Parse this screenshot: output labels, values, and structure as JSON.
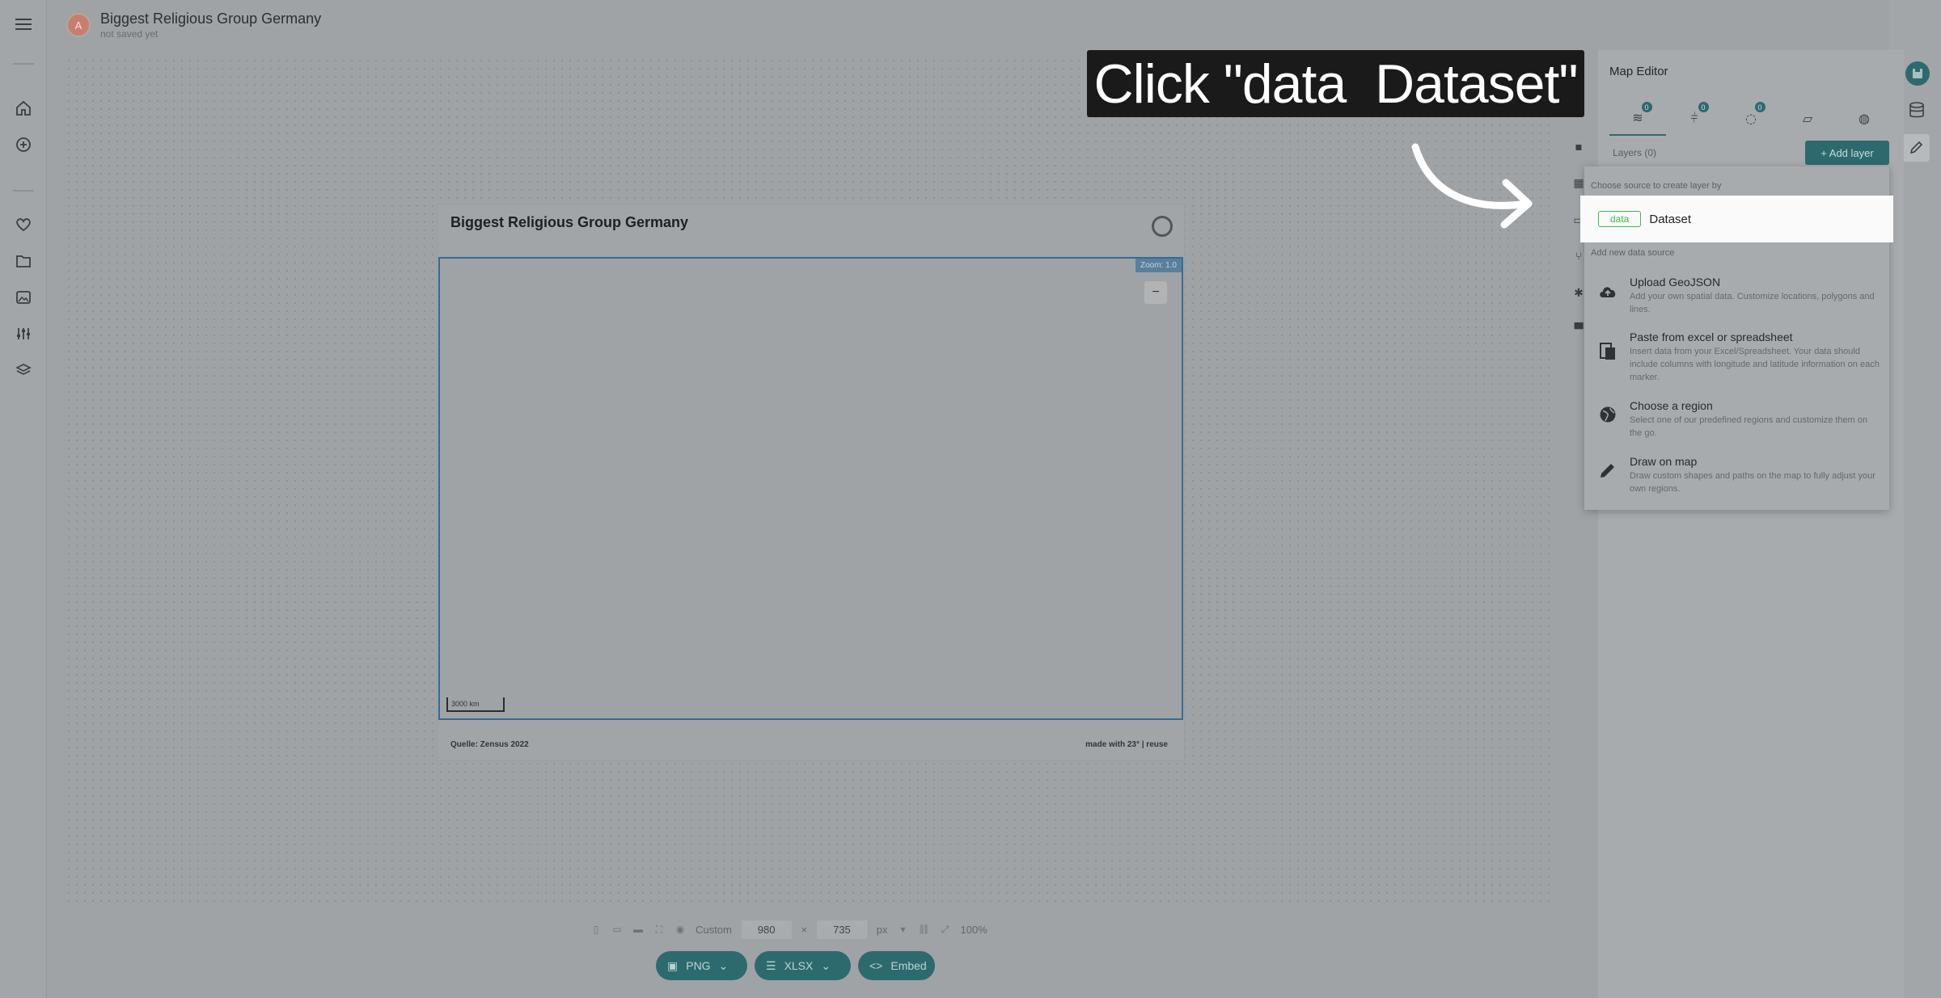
{
  "app": {
    "avatar_letter": "A",
    "doc_title": "Biggest Religious Group Germany",
    "doc_status": "not saved yet"
  },
  "map_card": {
    "title": "Biggest Religious Group Germany",
    "zoom_label": "Zoom: 1.0",
    "zoom_in": "+",
    "zoom_out": "−",
    "scale_label": "3000 km",
    "source": "Quelle: Zensus 2022",
    "made_with": "made with 23° | reuse"
  },
  "size_toolbar": {
    "preset": "Custom",
    "width": "980",
    "times": "×",
    "height": "735",
    "unit": "px",
    "zoom": "100%"
  },
  "export": {
    "png": "PNG",
    "xlsx": "XLSX",
    "embed": "Embed"
  },
  "editor": {
    "title": "Map Editor",
    "tabs": [
      {
        "icon": "layers-icon",
        "count": "0"
      },
      {
        "icon": "filter-icon",
        "count": "0"
      },
      {
        "icon": "marker-icon",
        "count": "0"
      },
      {
        "icon": "map-icon",
        "count": ""
      },
      {
        "icon": "globe-icon",
        "count": ""
      }
    ],
    "layers_label": "Layers (0)",
    "add_layer": "+ Add layer"
  },
  "dropdown": {
    "choose_heading": "Choose source to create layer by",
    "dataset_tag": "data",
    "dataset_label": "Dataset",
    "new_heading": "Add new data source",
    "sources": [
      {
        "title": "Upload GeoJSON",
        "desc": "Add your own spatial data. Customize locations, polygons and lines."
      },
      {
        "title": "Paste from excel or spreadsheet",
        "desc": "Insert data from your Excel/Spreadsheet. Your data should include columns with longitude and latitude information on each marker."
      },
      {
        "title": "Choose a region",
        "desc": "Select one of our predefined regions and customize them on the go."
      },
      {
        "title": "Draw on map",
        "desc": "Draw custom shapes and paths on the map to fully adjust your own regions."
      }
    ]
  },
  "tutorial": {
    "instruction": "Click \"data  Dataset\""
  },
  "colors": {
    "accent": "#2d6a6d",
    "data_tag": "#3fb950",
    "callout_bg": "#1a1a1a"
  }
}
